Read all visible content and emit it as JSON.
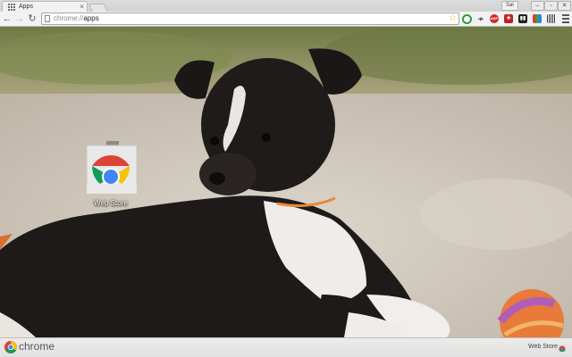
{
  "window": {
    "tab_title": "Apps",
    "tab_close": "×",
    "user_badge": "Sal"
  },
  "toolbar": {
    "url_scheme": "chrome://",
    "url_path": "apps",
    "back_icon": "←",
    "forward_icon": "→",
    "reload_icon": "↻",
    "star_icon": "☆"
  },
  "extensions": [
    {
      "name": "green-ring-extension",
      "color": "#2e9b3a",
      "glyph": "O"
    },
    {
      "name": "swirl-extension",
      "color": "#3a3a3a",
      "glyph": "ǂ"
    },
    {
      "name": "adblock-extension",
      "color": "#d52b2b",
      "glyph": "ABP"
    },
    {
      "name": "red-square-extension",
      "color": "#c0201f",
      "glyph": "✚"
    },
    {
      "name": "black-bars-extension",
      "color": "#222222",
      "glyph": "▮"
    },
    {
      "name": "color-grid-extension",
      "color": "#3a7bd5",
      "glyph": "▦"
    },
    {
      "name": "barcode-extension",
      "color": "#444444",
      "glyph": "▥"
    }
  ],
  "apps": [
    {
      "label": "Web Store"
    }
  ],
  "bottom": {
    "brand": "chrome",
    "link": "Web Store"
  },
  "colors": {
    "chrome_red": "#db4437",
    "chrome_yellow": "#f4c20d",
    "chrome_green": "#0f9d58",
    "chrome_blue": "#4285f4"
  }
}
